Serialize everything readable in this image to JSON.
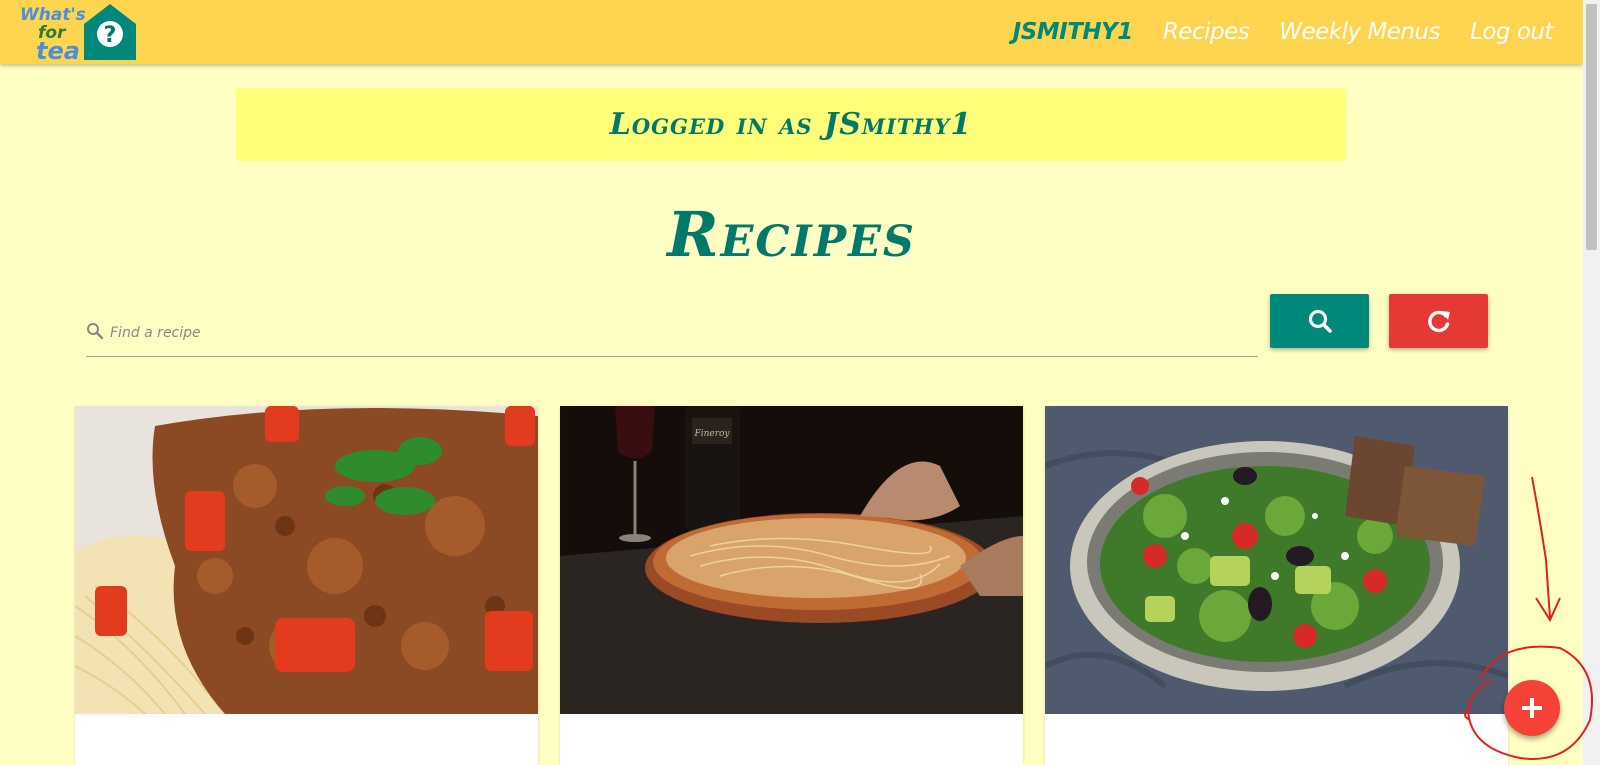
{
  "navbar": {
    "logo_text": "What's for tea?",
    "user_link": "JSMITHY1",
    "links": [
      "Recipes",
      "Weekly Menus",
      "Log out"
    ]
  },
  "banner": {
    "text": "Logged in as JSmithy1"
  },
  "page": {
    "title": "Recipes"
  },
  "search": {
    "placeholder": "Find a recipe"
  },
  "buttons": {
    "search_icon": "search-icon",
    "reset_icon": "refresh-icon",
    "add_icon": "plus-icon"
  },
  "cards": [
    {
      "image": "spaghetti-bolognese-photo"
    },
    {
      "image": "pizza-photo"
    },
    {
      "image": "salad-photo"
    }
  ],
  "colors": {
    "navbar": "#ffd54f",
    "background": "#ffffc4",
    "banner": "#ffff7a",
    "teal": "#00897b",
    "red": "#e53935"
  }
}
